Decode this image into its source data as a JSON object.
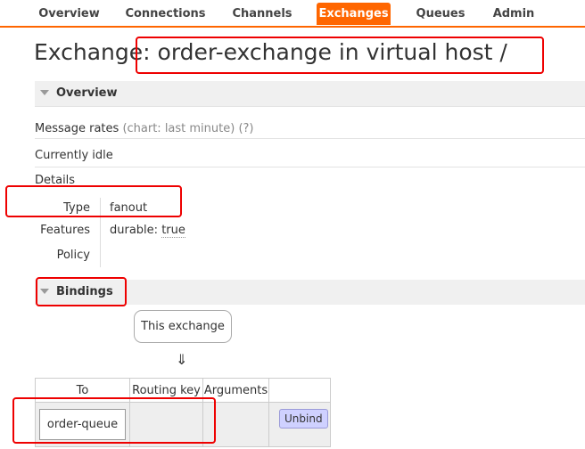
{
  "nav": {
    "tabs": [
      {
        "label": "Overview",
        "active": false
      },
      {
        "label": "Connections",
        "active": false
      },
      {
        "label": "Channels",
        "active": false
      },
      {
        "label": "Exchanges",
        "active": true
      },
      {
        "label": "Queues",
        "active": false
      },
      {
        "label": "Admin",
        "active": false
      }
    ]
  },
  "page": {
    "title_prefix": "Exchange",
    "title_rest": ": order-exchange in virtual host /"
  },
  "overview": {
    "section_title": "Overview",
    "message_rates_label": "Message rates",
    "message_rates_hint": "(chart: last minute) (?)",
    "status": "Currently idle",
    "details_label": "Details",
    "details": {
      "type_label": "Type",
      "type_value": "fanout",
      "features_label": "Features",
      "features_key": "durable:",
      "features_value": "true",
      "policy_label": "Policy"
    }
  },
  "bindings": {
    "section_title": "Bindings",
    "this_exchange_label": "This exchange",
    "arrow": "⇓",
    "columns": [
      "To",
      "Routing key",
      "Arguments",
      ""
    ],
    "rows": [
      {
        "to": "order-queue",
        "routing_key": "",
        "arguments": "",
        "action": "Unbind"
      }
    ]
  },
  "colors": {
    "accent": "#ff6600",
    "highlight": "#e00000",
    "unbind_button": "#cfd1ff"
  }
}
